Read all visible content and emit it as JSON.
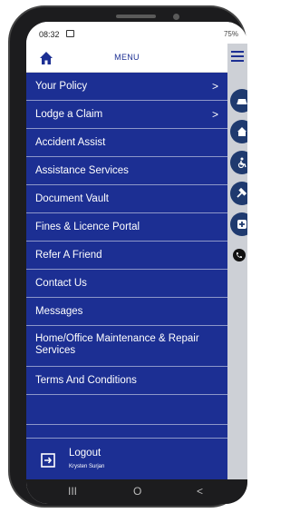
{
  "status_bar": {
    "time": "08:32",
    "battery": "75%"
  },
  "header": {
    "title": "MENU",
    "home_icon": "home-icon",
    "hamburger_icon": "hamburger-icon"
  },
  "menu": {
    "items": [
      {
        "label": "Your Policy",
        "chevron": ">"
      },
      {
        "label": "Lodge a Claim",
        "chevron": ">"
      },
      {
        "label": "Accident Assist"
      },
      {
        "label": "Assistance Services"
      },
      {
        "label": "Document Vault"
      },
      {
        "label": "Fines & Licence Portal"
      },
      {
        "label": "Refer A Friend"
      },
      {
        "label": "Contact Us"
      },
      {
        "label": "Messages"
      },
      {
        "label": "Home/Office Maintenance & Repair Services"
      },
      {
        "label": "Terms And Conditions"
      }
    ],
    "logout": {
      "label": "Logout",
      "user": "Krysten Surjan",
      "icon": "logout-icon"
    }
  },
  "rail_icons": [
    "car-icon",
    "house-icon",
    "wheelchair-icon",
    "gavel-icon",
    "medical-icon",
    "phone-icon"
  ],
  "nav": {
    "recent": "III",
    "home": "O",
    "back": "<"
  },
  "colors": {
    "menu_bg": "#1c2f93",
    "divider": "#8d97c9",
    "rail_bg": "#cdd0d6",
    "rail_btn": "#1f3a6f"
  }
}
